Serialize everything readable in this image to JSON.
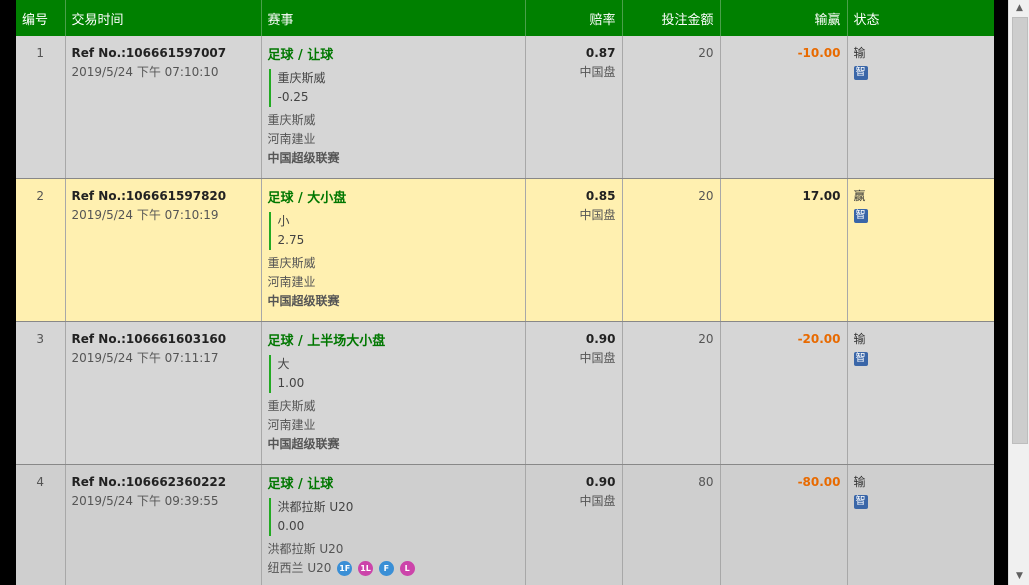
{
  "header": {
    "col_no": "编号",
    "col_time": "交易时间",
    "col_event": "赛事",
    "col_odds": "赔率",
    "col_stake": "投注金额",
    "col_winloss": "输赢",
    "col_status": "状态"
  },
  "rows": [
    {
      "no": "1",
      "ref": "Ref No.:106661597007",
      "time": "2019/5/24 下午 07:10:10",
      "sport_market": "足球 / 让球",
      "selection": "重庆斯威",
      "line": "-0.25",
      "home": "重庆斯威",
      "away": "河南建业",
      "league": "中国超级联赛",
      "odds": "0.87",
      "odds_type": "中国盘",
      "stake": "20",
      "winloss": "-10.00",
      "status": "输",
      "icon_glyph": "智"
    },
    {
      "no": "2",
      "ref": "Ref No.:106661597820",
      "time": "2019/5/24 下午 07:10:19",
      "sport_market": "足球 / 大小盘",
      "selection": "小",
      "line": "2.75",
      "home": "重庆斯威",
      "away": "河南建业",
      "league": "中国超级联赛",
      "odds": "0.85",
      "odds_type": "中国盘",
      "stake": "20",
      "winloss": "17.00",
      "status": "赢",
      "icon_glyph": "智"
    },
    {
      "no": "3",
      "ref": "Ref No.:106661603160",
      "time": "2019/5/24 下午 07:11:17",
      "sport_market": "足球 / 上半场大小盘",
      "selection": "大",
      "line": "1.00",
      "home": "重庆斯威",
      "away": "河南建业",
      "league": "中国超级联赛",
      "odds": "0.90",
      "odds_type": "中国盘",
      "stake": "20",
      "winloss": "-20.00",
      "status": "输",
      "icon_glyph": "智"
    },
    {
      "no": "4",
      "ref": "Ref No.:106662360222",
      "time": "2019/5/24 下午 09:39:55",
      "sport_market": "足球 / 让球",
      "selection": "洪都拉斯 U20",
      "line": "0.00",
      "home": "洪都拉斯 U20",
      "away": "纽西兰 U20",
      "badges": [
        "1F",
        "1L",
        "F",
        "L"
      ],
      "odds": "0.90",
      "odds_type": "中国盘",
      "stake": "80",
      "winloss": "-80.00",
      "status": "输",
      "icon_glyph": "智"
    }
  ],
  "colors": {
    "header_bg": "#008000",
    "row_odd": "#d6d6d6",
    "row_even": "#fff0b0",
    "market_text": "#007700",
    "loss_text": "#e86a00"
  },
  "scrollbar": {
    "up_icon": "▲",
    "down_icon": "▼"
  }
}
